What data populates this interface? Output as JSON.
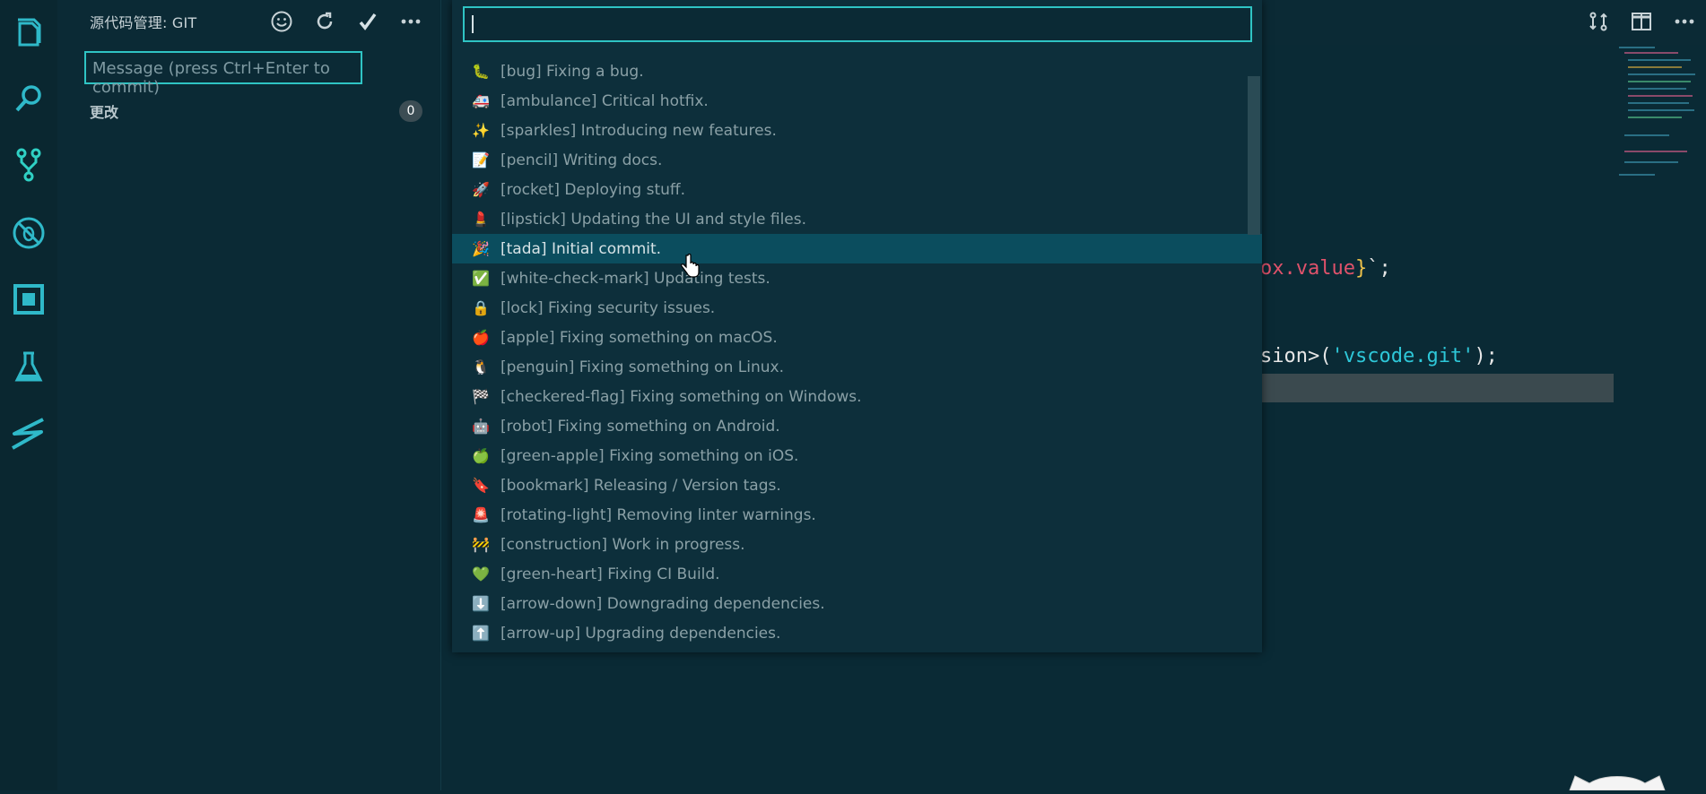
{
  "sidebar": {
    "title": "源代码管理: GIT",
    "actions": [
      {
        "icon": "smiley-icon"
      },
      {
        "icon": "refresh-icon"
      },
      {
        "icon": "check-icon"
      },
      {
        "icon": "more-icon"
      }
    ],
    "commit_placeholder": "Message (press Ctrl+Enter to commit)",
    "changes_label": "更改",
    "changes_count": "0"
  },
  "activity_bar": [
    {
      "icon": "explorer-icon"
    },
    {
      "icon": "search-icon"
    },
    {
      "icon": "source-control-icon"
    },
    {
      "icon": "debug-icon"
    },
    {
      "icon": "extensions-icon"
    },
    {
      "icon": "test-flask-icon"
    },
    {
      "icon": "live-share-icon"
    }
  ],
  "editor": {
    "code_line_1": {
      "var": "ox.value",
      "brace_close": "}",
      "tail": "`;"
    },
    "code_line_2": {
      "pre": "sion>(",
      "str": "'vscode.git'",
      "tail": ");"
    },
    "actions": [
      {
        "icon": "compare-changes-icon"
      },
      {
        "icon": "split-editor-icon"
      },
      {
        "icon": "more-icon"
      }
    ]
  },
  "quick_pick": {
    "input_value": "",
    "items": [
      {
        "emoji": "🐛",
        "label": "[bug] Fixing a bug."
      },
      {
        "emoji": "🚑",
        "label": "[ambulance] Critical hotfix."
      },
      {
        "emoji": "✨",
        "label": "[sparkles] Introducing new features."
      },
      {
        "emoji": "📝",
        "label": "[pencil] Writing docs."
      },
      {
        "emoji": "🚀",
        "label": "[rocket] Deploying stuff."
      },
      {
        "emoji": "💄",
        "label": "[lipstick] Updating the UI and style files."
      },
      {
        "emoji": "🎉",
        "label": "[tada] Initial commit."
      },
      {
        "emoji": "✅",
        "label": "[white-check-mark] Updating tests."
      },
      {
        "emoji": "🔒",
        "label": "[lock] Fixing security issues."
      },
      {
        "emoji": "🍎",
        "label": "[apple] Fixing something on macOS."
      },
      {
        "emoji": "🐧",
        "label": "[penguin] Fixing something on Linux."
      },
      {
        "emoji": "🏁",
        "label": "[checkered-flag] Fixing something on Windows."
      },
      {
        "emoji": "🤖",
        "label": "[robot] Fixing something on Android."
      },
      {
        "emoji": "🍏",
        "label": "[green-apple] Fixing something on iOS."
      },
      {
        "emoji": "🔖",
        "label": "[bookmark] Releasing / Version tags."
      },
      {
        "emoji": "🚨",
        "label": "[rotating-light] Removing linter warnings."
      },
      {
        "emoji": "🚧",
        "label": "[construction] Work in progress."
      },
      {
        "emoji": "💚",
        "label": "[green-heart] Fixing CI Build."
      },
      {
        "emoji": "⬇️",
        "label": "[arrow-down] Downgrading dependencies."
      },
      {
        "emoji": "⬆️",
        "label": "[arrow-up] Upgrading dependencies."
      }
    ],
    "selected_index": 6
  },
  "colors": {
    "accent": "#2fc4c4",
    "background": "#0b2a35",
    "selection": "#0b4d5e"
  }
}
